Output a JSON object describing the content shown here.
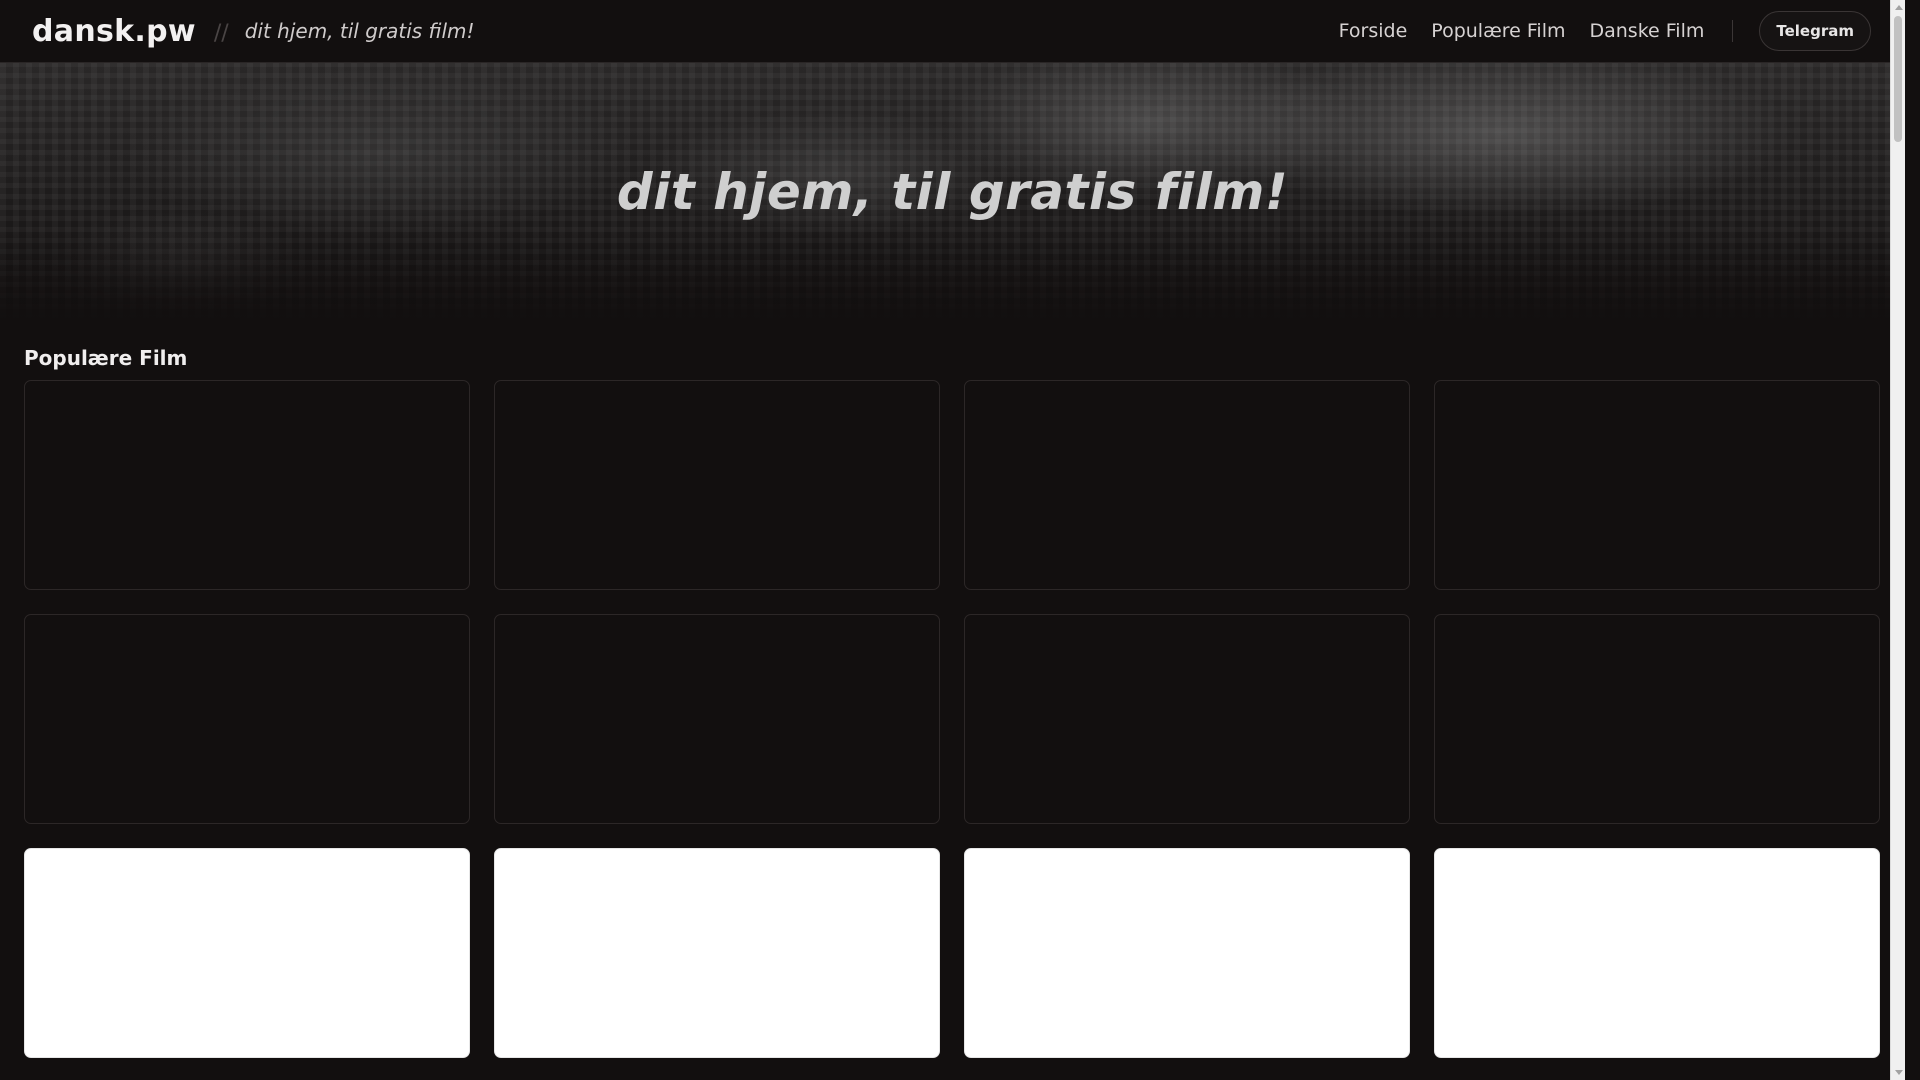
{
  "header": {
    "brand": "dansk.pw",
    "separator": "//",
    "tagline": "dit hjem, til gratis film!",
    "nav": [
      {
        "label": "Forside"
      },
      {
        "label": "Populære Film"
      },
      {
        "label": "Danske Film"
      }
    ],
    "telegram_label": "Telegram"
  },
  "hero": {
    "title": "dit hjem, til gratis film!"
  },
  "section": {
    "title": "Populære Film",
    "cards": [
      {
        "style": "dark"
      },
      {
        "style": "dark"
      },
      {
        "style": "dark"
      },
      {
        "style": "dark"
      },
      {
        "style": "dark"
      },
      {
        "style": "dark"
      },
      {
        "style": "dark"
      },
      {
        "style": "dark"
      },
      {
        "style": "white"
      },
      {
        "style": "white"
      },
      {
        "style": "white"
      },
      {
        "style": "white"
      }
    ]
  },
  "colors": {
    "background": "#120f0f",
    "text": "#e8e6e6",
    "card_border": "#2c2727"
  },
  "icons": {
    "scroll_up": "triangle-up-icon",
    "scroll_down": "triangle-down-icon"
  }
}
